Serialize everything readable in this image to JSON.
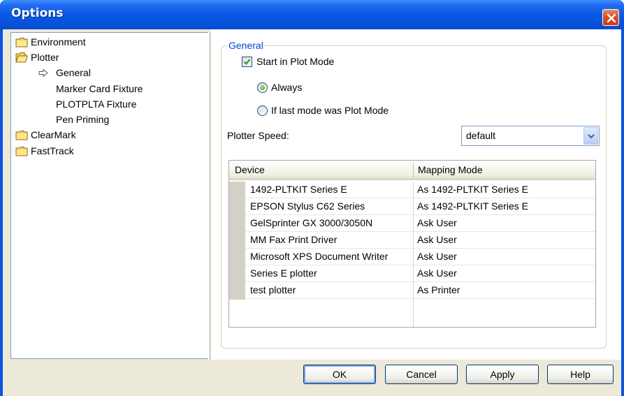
{
  "window": {
    "title": "Options"
  },
  "tree": {
    "items": [
      {
        "label": "Environment",
        "type": "folder"
      },
      {
        "label": "Plotter",
        "type": "folder-open"
      },
      {
        "label": "General",
        "type": "selected-child"
      },
      {
        "label": "Marker Card Fixture",
        "type": "child"
      },
      {
        "label": "PLOTPLTA Fixture",
        "type": "child"
      },
      {
        "label": "Pen Priming",
        "type": "child"
      },
      {
        "label": "ClearMark",
        "type": "folder"
      },
      {
        "label": "FastTrack",
        "type": "folder"
      }
    ]
  },
  "general": {
    "legend": "General",
    "start_in_plot_mode": {
      "label": "Start in Plot Mode",
      "checked": true
    },
    "radio_always": {
      "label": "Always",
      "selected": true
    },
    "radio_last_mode": {
      "label": "If last mode was Plot Mode",
      "selected": false
    },
    "plotter_speed": {
      "label": "Plotter Speed:",
      "value": "default"
    }
  },
  "grid": {
    "headers": [
      "Device",
      "Mapping Mode"
    ],
    "rows": [
      [
        "1492-PLTKIT Series E",
        "As 1492-PLTKIT Series E"
      ],
      [
        "EPSON Stylus C62 Series",
        "As 1492-PLTKIT Series E"
      ],
      [
        "GelSprinter GX 3000/3050N",
        "Ask User"
      ],
      [
        "MM Fax Print Driver",
        "Ask User"
      ],
      [
        "Microsoft XPS Document Writer",
        "Ask User"
      ],
      [
        "Series E plotter",
        "Ask User"
      ],
      [
        "test plotter",
        "As Printer"
      ]
    ]
  },
  "buttons": {
    "ok": "OK",
    "cancel": "Cancel",
    "apply": "Apply",
    "help": "Help"
  },
  "colors": {
    "titlebar": "#0a58e6",
    "client": "#ece9d8",
    "legend": "#0046d5",
    "close": "#d7512c"
  }
}
